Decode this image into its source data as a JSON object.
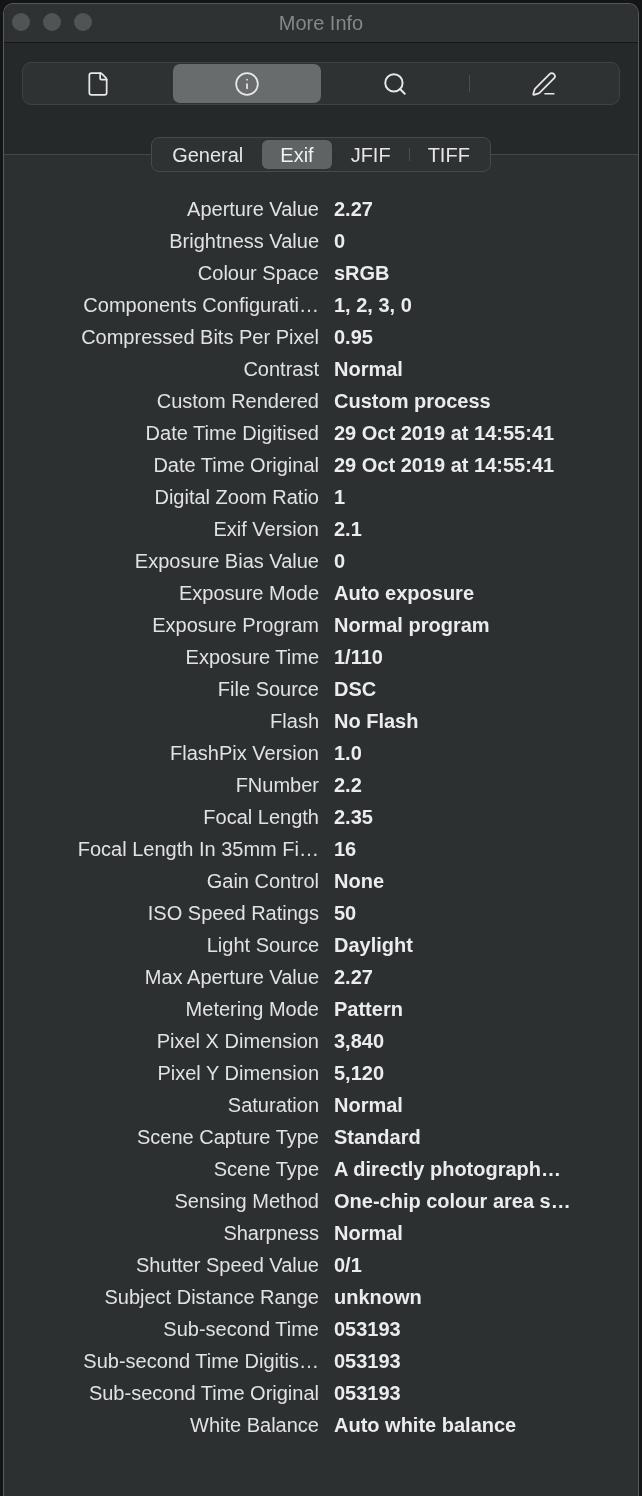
{
  "window": {
    "title": "More Info"
  },
  "toolbar": [
    {
      "kind": "document",
      "selected": false
    },
    {
      "kind": "info",
      "selected": true
    },
    {
      "kind": "search",
      "selected": false
    },
    {
      "kind": "markup",
      "selected": false
    }
  ],
  "tabs": [
    {
      "label": "General",
      "selected": false
    },
    {
      "label": "Exif",
      "selected": true
    },
    {
      "label": "JFIF",
      "selected": false
    },
    {
      "label": "TIFF",
      "selected": false
    }
  ],
  "rows": [
    {
      "label": "Aperture Value",
      "value": "2.27"
    },
    {
      "label": "Brightness Value",
      "value": "0"
    },
    {
      "label": "Colour Space",
      "value": "sRGB"
    },
    {
      "label": "Components Configurati…",
      "value": "1, 2, 3, 0"
    },
    {
      "label": "Compressed Bits Per Pixel",
      "value": "0.95"
    },
    {
      "label": "Contrast",
      "value": "Normal"
    },
    {
      "label": "Custom Rendered",
      "value": "Custom process"
    },
    {
      "label": "Date Time Digitised",
      "value": "29 Oct 2019 at 14:55:41"
    },
    {
      "label": "Date Time Original",
      "value": "29 Oct 2019 at 14:55:41"
    },
    {
      "label": "Digital Zoom Ratio",
      "value": "1"
    },
    {
      "label": "Exif Version",
      "value": "2.1"
    },
    {
      "label": "Exposure Bias Value",
      "value": "0"
    },
    {
      "label": "Exposure Mode",
      "value": "Auto exposure"
    },
    {
      "label": "Exposure Program",
      "value": "Normal program"
    },
    {
      "label": "Exposure Time",
      "value": "1/110"
    },
    {
      "label": "File Source",
      "value": "DSC"
    },
    {
      "label": "Flash",
      "value": "No Flash"
    },
    {
      "label": "FlashPix Version",
      "value": "1.0"
    },
    {
      "label": "FNumber",
      "value": "2.2"
    },
    {
      "label": "Focal Length",
      "value": "2.35"
    },
    {
      "label": "Focal Length In 35mm Fi…",
      "value": "16"
    },
    {
      "label": "Gain Control",
      "value": "None"
    },
    {
      "label": "ISO Speed Ratings",
      "value": "50"
    },
    {
      "label": "Light Source",
      "value": "Daylight"
    },
    {
      "label": "Max Aperture Value",
      "value": "2.27"
    },
    {
      "label": "Metering Mode",
      "value": "Pattern"
    },
    {
      "label": "Pixel X Dimension",
      "value": "3,840"
    },
    {
      "label": "Pixel Y Dimension",
      "value": "5,120"
    },
    {
      "label": "Saturation",
      "value": "Normal"
    },
    {
      "label": "Scene Capture Type",
      "value": "Standard"
    },
    {
      "label": "Scene Type",
      "value": "A directly photograph…"
    },
    {
      "label": "Sensing Method",
      "value": "One-chip colour area s…"
    },
    {
      "label": "Sharpness",
      "value": "Normal"
    },
    {
      "label": "Shutter Speed Value",
      "value": "0/1"
    },
    {
      "label": "Subject Distance Range",
      "value": "unknown"
    },
    {
      "label": "Sub-second Time",
      "value": "053193"
    },
    {
      "label": "Sub-second Time Digitis…",
      "value": "053193"
    },
    {
      "label": "Sub-second Time Original",
      "value": "053193"
    },
    {
      "label": "White Balance",
      "value": "Auto white balance"
    }
  ]
}
